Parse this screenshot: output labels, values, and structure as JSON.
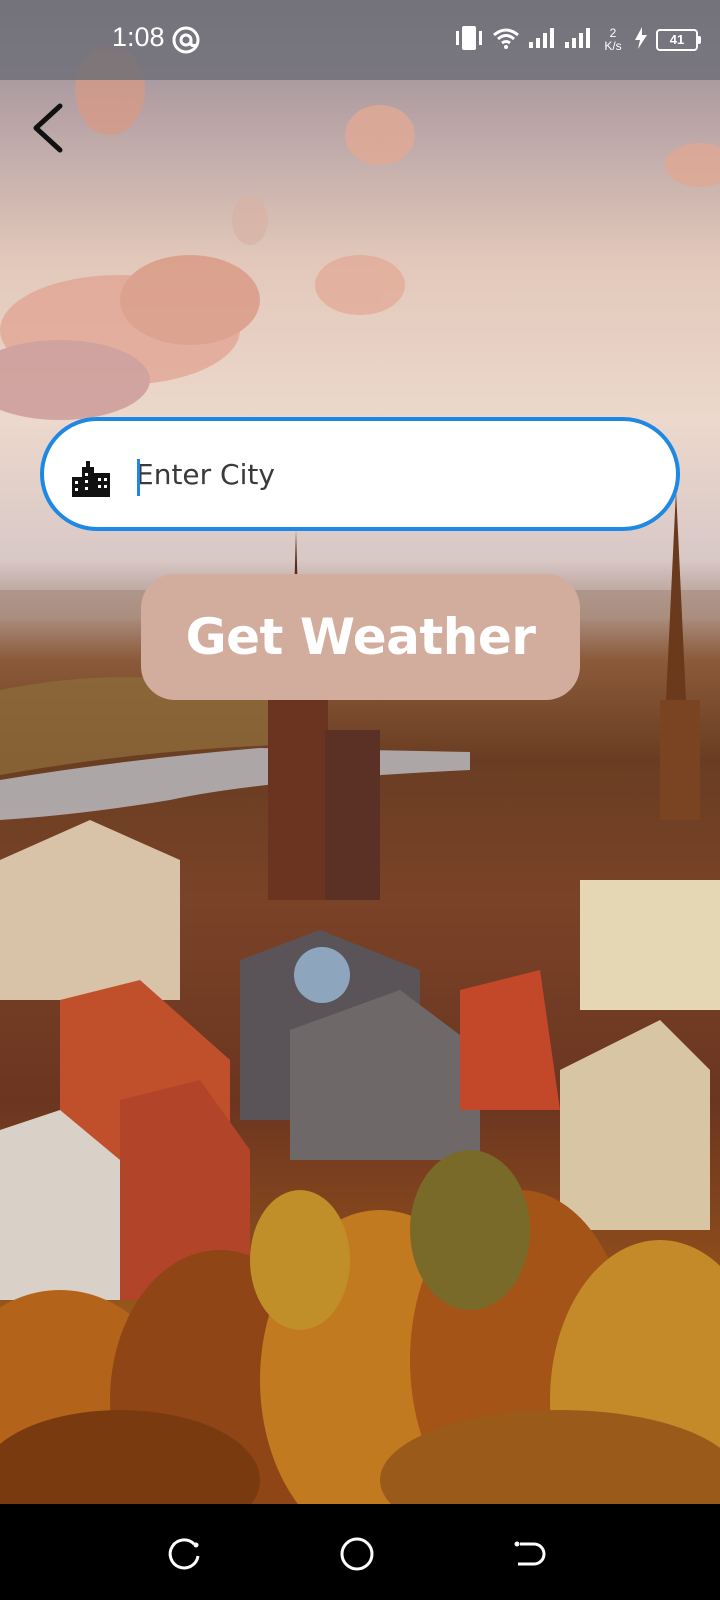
{
  "status_bar": {
    "time": "1:08",
    "net_speed_value": "2",
    "net_speed_unit": "K/s",
    "battery_level": "41",
    "icons": [
      "at-sign-icon",
      "vibrate-icon",
      "wifi-icon",
      "signal-icon",
      "signal-icon",
      "charging-icon",
      "battery-icon"
    ]
  },
  "header": {
    "back_icon": "chevron-left-icon"
  },
  "search": {
    "placeholder": "Enter City",
    "value": "",
    "icon": "city-buildings-icon",
    "border_color": "#1e88e5"
  },
  "actions": {
    "get_weather_label": "Get Weather",
    "button_color": "#d2ad9d"
  },
  "nav_bar": {
    "icons": [
      "recents-icon",
      "home-icon",
      "back-nav-icon"
    ]
  }
}
